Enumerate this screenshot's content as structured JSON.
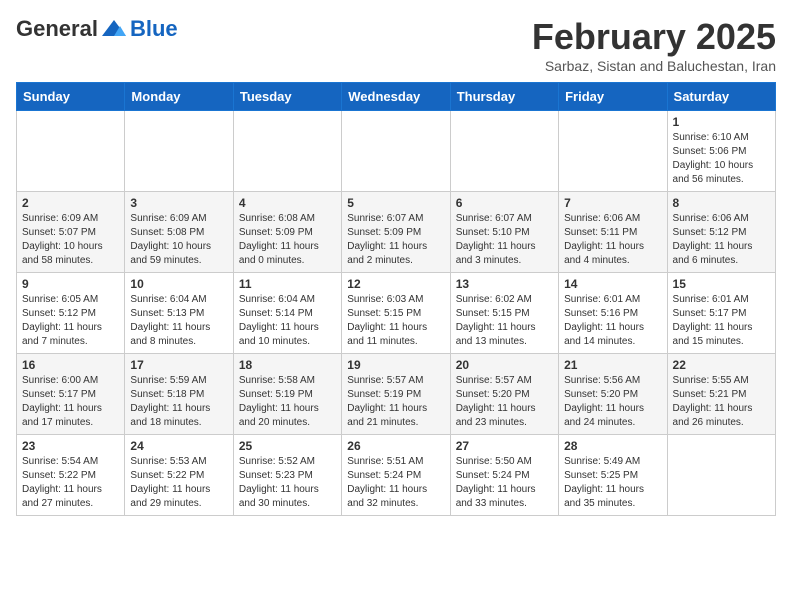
{
  "header": {
    "logo_general": "General",
    "logo_blue": "Blue",
    "month_title": "February 2025",
    "subtitle": "Sarbaz, Sistan and Baluchestan, Iran"
  },
  "calendar": {
    "days_of_week": [
      "Sunday",
      "Monday",
      "Tuesday",
      "Wednesday",
      "Thursday",
      "Friday",
      "Saturday"
    ],
    "weeks": [
      [
        {
          "day": "",
          "info": ""
        },
        {
          "day": "",
          "info": ""
        },
        {
          "day": "",
          "info": ""
        },
        {
          "day": "",
          "info": ""
        },
        {
          "day": "",
          "info": ""
        },
        {
          "day": "",
          "info": ""
        },
        {
          "day": "1",
          "info": "Sunrise: 6:10 AM\nSunset: 5:06 PM\nDaylight: 10 hours and 56 minutes."
        }
      ],
      [
        {
          "day": "2",
          "info": "Sunrise: 6:09 AM\nSunset: 5:07 PM\nDaylight: 10 hours and 58 minutes."
        },
        {
          "day": "3",
          "info": "Sunrise: 6:09 AM\nSunset: 5:08 PM\nDaylight: 10 hours and 59 minutes."
        },
        {
          "day": "4",
          "info": "Sunrise: 6:08 AM\nSunset: 5:09 PM\nDaylight: 11 hours and 0 minutes."
        },
        {
          "day": "5",
          "info": "Sunrise: 6:07 AM\nSunset: 5:09 PM\nDaylight: 11 hours and 2 minutes."
        },
        {
          "day": "6",
          "info": "Sunrise: 6:07 AM\nSunset: 5:10 PM\nDaylight: 11 hours and 3 minutes."
        },
        {
          "day": "7",
          "info": "Sunrise: 6:06 AM\nSunset: 5:11 PM\nDaylight: 11 hours and 4 minutes."
        },
        {
          "day": "8",
          "info": "Sunrise: 6:06 AM\nSunset: 5:12 PM\nDaylight: 11 hours and 6 minutes."
        }
      ],
      [
        {
          "day": "9",
          "info": "Sunrise: 6:05 AM\nSunset: 5:12 PM\nDaylight: 11 hours and 7 minutes."
        },
        {
          "day": "10",
          "info": "Sunrise: 6:04 AM\nSunset: 5:13 PM\nDaylight: 11 hours and 8 minutes."
        },
        {
          "day": "11",
          "info": "Sunrise: 6:04 AM\nSunset: 5:14 PM\nDaylight: 11 hours and 10 minutes."
        },
        {
          "day": "12",
          "info": "Sunrise: 6:03 AM\nSunset: 5:15 PM\nDaylight: 11 hours and 11 minutes."
        },
        {
          "day": "13",
          "info": "Sunrise: 6:02 AM\nSunset: 5:15 PM\nDaylight: 11 hours and 13 minutes."
        },
        {
          "day": "14",
          "info": "Sunrise: 6:01 AM\nSunset: 5:16 PM\nDaylight: 11 hours and 14 minutes."
        },
        {
          "day": "15",
          "info": "Sunrise: 6:01 AM\nSunset: 5:17 PM\nDaylight: 11 hours and 15 minutes."
        }
      ],
      [
        {
          "day": "16",
          "info": "Sunrise: 6:00 AM\nSunset: 5:17 PM\nDaylight: 11 hours and 17 minutes."
        },
        {
          "day": "17",
          "info": "Sunrise: 5:59 AM\nSunset: 5:18 PM\nDaylight: 11 hours and 18 minutes."
        },
        {
          "day": "18",
          "info": "Sunrise: 5:58 AM\nSunset: 5:19 PM\nDaylight: 11 hours and 20 minutes."
        },
        {
          "day": "19",
          "info": "Sunrise: 5:57 AM\nSunset: 5:19 PM\nDaylight: 11 hours and 21 minutes."
        },
        {
          "day": "20",
          "info": "Sunrise: 5:57 AM\nSunset: 5:20 PM\nDaylight: 11 hours and 23 minutes."
        },
        {
          "day": "21",
          "info": "Sunrise: 5:56 AM\nSunset: 5:20 PM\nDaylight: 11 hours and 24 minutes."
        },
        {
          "day": "22",
          "info": "Sunrise: 5:55 AM\nSunset: 5:21 PM\nDaylight: 11 hours and 26 minutes."
        }
      ],
      [
        {
          "day": "23",
          "info": "Sunrise: 5:54 AM\nSunset: 5:22 PM\nDaylight: 11 hours and 27 minutes."
        },
        {
          "day": "24",
          "info": "Sunrise: 5:53 AM\nSunset: 5:22 PM\nDaylight: 11 hours and 29 minutes."
        },
        {
          "day": "25",
          "info": "Sunrise: 5:52 AM\nSunset: 5:23 PM\nDaylight: 11 hours and 30 minutes."
        },
        {
          "day": "26",
          "info": "Sunrise: 5:51 AM\nSunset: 5:24 PM\nDaylight: 11 hours and 32 minutes."
        },
        {
          "day": "27",
          "info": "Sunrise: 5:50 AM\nSunset: 5:24 PM\nDaylight: 11 hours and 33 minutes."
        },
        {
          "day": "28",
          "info": "Sunrise: 5:49 AM\nSunset: 5:25 PM\nDaylight: 11 hours and 35 minutes."
        },
        {
          "day": "",
          "info": ""
        }
      ]
    ]
  }
}
